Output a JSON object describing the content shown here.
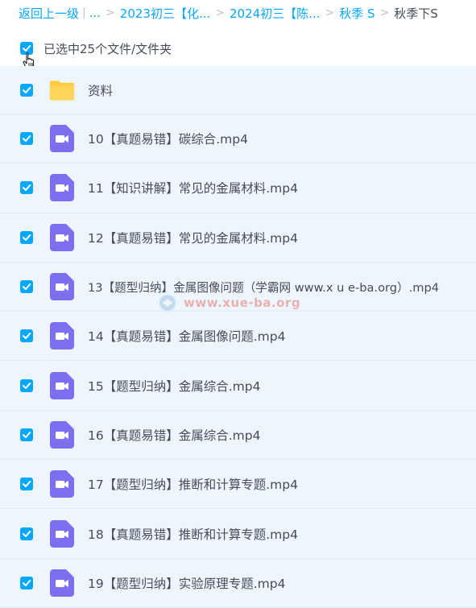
{
  "breadcrumb": {
    "back_label": "返回上一级",
    "ellipsis": "...",
    "items": [
      "2023初三【化...",
      "2024初三【陈...",
      "秋季 S"
    ],
    "current": "秋季下S"
  },
  "selection": {
    "label": "已选中25个文件/文件夹"
  },
  "files": [
    {
      "name": "资料",
      "type": "folder"
    },
    {
      "name": "10【真题易错】碳综合.mp4",
      "type": "video"
    },
    {
      "name": "11【知识讲解】常见的金属材料.mp4",
      "type": "video"
    },
    {
      "name": "12【真题易错】常见的金属材料.mp4",
      "type": "video"
    },
    {
      "name": "13【题型归纳】金属图像问题（学霸网 www.x u e-ba.org）.mp4",
      "type": "video"
    },
    {
      "name": "14【真题易错】金属图像问题.mp4",
      "type": "video"
    },
    {
      "name": "15【题型归纳】金属综合.mp4",
      "type": "video"
    },
    {
      "name": "16【真题易错】金属综合.mp4",
      "type": "video"
    },
    {
      "name": "17【题型归纳】推断和计算专题.mp4",
      "type": "video"
    },
    {
      "name": "18【真题易错】推断和计算专题.mp4",
      "type": "video"
    },
    {
      "name": "19【题型归纳】实验原理专题.mp4",
      "type": "video"
    }
  ],
  "watermark": {
    "text": "www.xue-ba.org"
  },
  "colors": {
    "accent": "#06a7ff",
    "video_icon": "#7c6ff0",
    "folder": "#ffcc3f",
    "row_bg": "#eef6fd"
  }
}
